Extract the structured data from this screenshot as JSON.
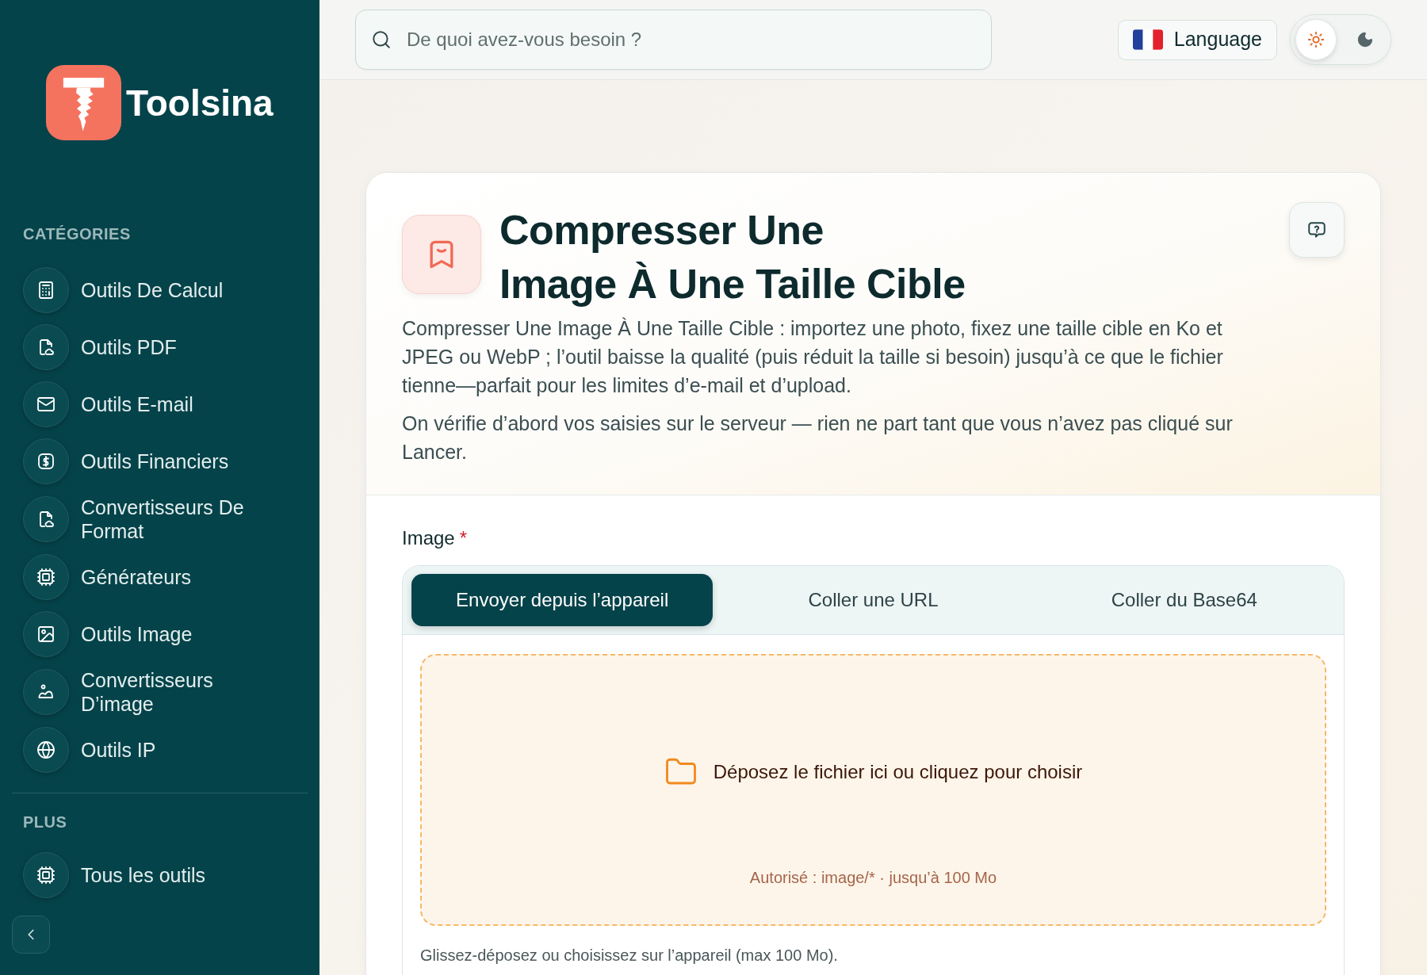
{
  "sidebar": {
    "brand": {
      "name": "Toolsina"
    },
    "sections": [
      {
        "heading": "CATÉGORIES",
        "items": [
          {
            "label": "Outils De Calcul",
            "selected": false
          },
          {
            "label": "Outils PDF",
            "selected": false
          },
          {
            "label": "Outils E-mail",
            "selected": false
          },
          {
            "label": "Outils Financiers",
            "selected": false
          },
          {
            "label": "Convertisseurs De Format",
            "selected": false
          },
          {
            "label": "Générateurs",
            "selected": false
          },
          {
            "label": "Outils Image",
            "selected": false
          },
          {
            "label": "Convertisseurs D’image",
            "selected": false
          },
          {
            "label": "Outils IP",
            "selected": false
          }
        ]
      },
      {
        "heading": "PLUS",
        "items": [
          {
            "label": "Tous les outils",
            "selected": false
          }
        ]
      }
    ]
  },
  "topbar": {
    "search": {
      "placeholder": "De quoi avez-vous besoin ?"
    },
    "language_button": {
      "label": "Language"
    },
    "theme_toggle": {
      "options": [
        {
          "kind": "light",
          "selected": true
        },
        {
          "kind": "dark",
          "selected": false
        }
      ]
    }
  },
  "tool": {
    "title": "Compresser Une\nImage À Une Taille Cible",
    "description": [
      "Compresser Une Image À Une Taille Cible : importez une photo, fixez une taille cible en Ko et JPEG ou WebP ; l’outil baisse la qualité (puis réduit la taille si besoin) jusqu’à ce que le fichier tienne—parfait pour les limites d’e-mail et d’upload.",
      "On vérifie d’abord vos saisies sur le serveur — rien ne part tant que vous n’avez pas cliqué sur Lancer."
    ],
    "field": {
      "label": "Image",
      "required_mark": "*",
      "tabs": [
        {
          "label": "Envoyer depuis l’appareil",
          "selected": true
        },
        {
          "label": "Coller une URL",
          "selected": false
        },
        {
          "label": "Coller du Base64",
          "selected": false
        }
      ],
      "dropzone": {
        "prompt": "Déposez le fichier ici ou cliquez pour choisir",
        "hint": "Autorisé : image/* · jusqu’à 100 Mo"
      },
      "helper": "Glissez-déposez ou choisissez sur l’appareil (max 100 Mo)."
    }
  }
}
